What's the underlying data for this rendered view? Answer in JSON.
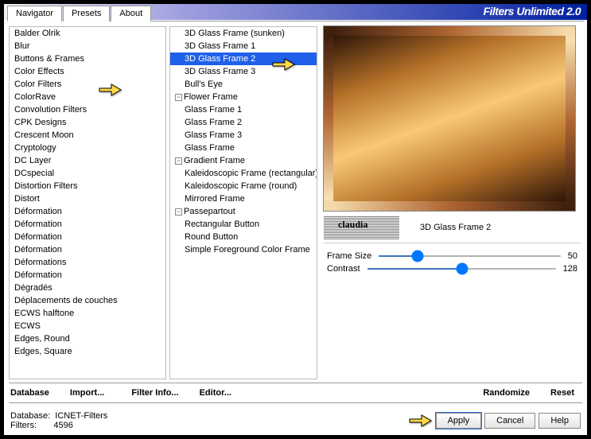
{
  "title": "Filters Unlimited 2.0",
  "tabs": [
    "Navigator",
    "Presets",
    "About"
  ],
  "activeTab": 0,
  "categories": [
    "Balder Olrik",
    "Blur",
    "Buttons & Frames",
    "Color Effects",
    "Color Filters",
    "ColorRave",
    "Convolution Filters",
    "CPK Designs",
    "Crescent Moon",
    "Cryptology",
    "DC Layer",
    "DCspecial",
    "Distortion Filters",
    "Distort",
    "Déformation",
    "Déformation",
    "Déformation",
    "Déformation",
    "Déformations",
    "Déformation",
    "Dégradés",
    "Déplacements de couches",
    "ECWS halftone",
    "ECWS",
    "Edges, Round",
    "Edges, Square"
  ],
  "categoriesSelectedIndex": 2,
  "filters": [
    {
      "t": "3D Glass Frame (sunken)",
      "i": true
    },
    {
      "t": "3D Glass Frame 1",
      "i": true
    },
    {
      "t": "3D Glass Frame 2",
      "i": true,
      "sel": true
    },
    {
      "t": "3D Glass Frame 3",
      "i": true
    },
    {
      "t": "Bull's Eye",
      "i": true
    },
    {
      "t": "Flower Frame",
      "exp": true
    },
    {
      "t": "Glass Frame 1",
      "i": true
    },
    {
      "t": "Glass Frame 2",
      "i": true
    },
    {
      "t": "Glass Frame 3",
      "i": true
    },
    {
      "t": "Glass Frame",
      "i": true
    },
    {
      "t": "Gradient Frame",
      "exp": true
    },
    {
      "t": "Kaleidoscopic Frame (rectangular)",
      "i": true
    },
    {
      "t": "Kaleidoscopic Frame (round)",
      "i": true
    },
    {
      "t": "Mirrored Frame",
      "i": true
    },
    {
      "t": "Passepartout",
      "exp": true
    },
    {
      "t": "Rectangular Button",
      "i": true
    },
    {
      "t": "Round Button",
      "i": true
    },
    {
      "t": "Simple Foreground Color Frame",
      "i": true
    }
  ],
  "selectedFilterName": "3D Glass Frame 2",
  "params": [
    {
      "name": "Frame Size",
      "value": 50,
      "min": 0,
      "max": 255
    },
    {
      "name": "Contrast",
      "value": 128,
      "min": 0,
      "max": 255
    }
  ],
  "buttons": {
    "database": "Database",
    "import": "Import...",
    "filterinfo": "Filter Info...",
    "editor": "Editor...",
    "randomize": "Randomize",
    "reset": "Reset",
    "apply": "Apply",
    "cancel": "Cancel",
    "help": "Help"
  },
  "status": {
    "dbLabel": "Database:",
    "dbName": "ICNET-Filters",
    "filtersLabel": "Filters:",
    "filtersCount": "4596"
  }
}
